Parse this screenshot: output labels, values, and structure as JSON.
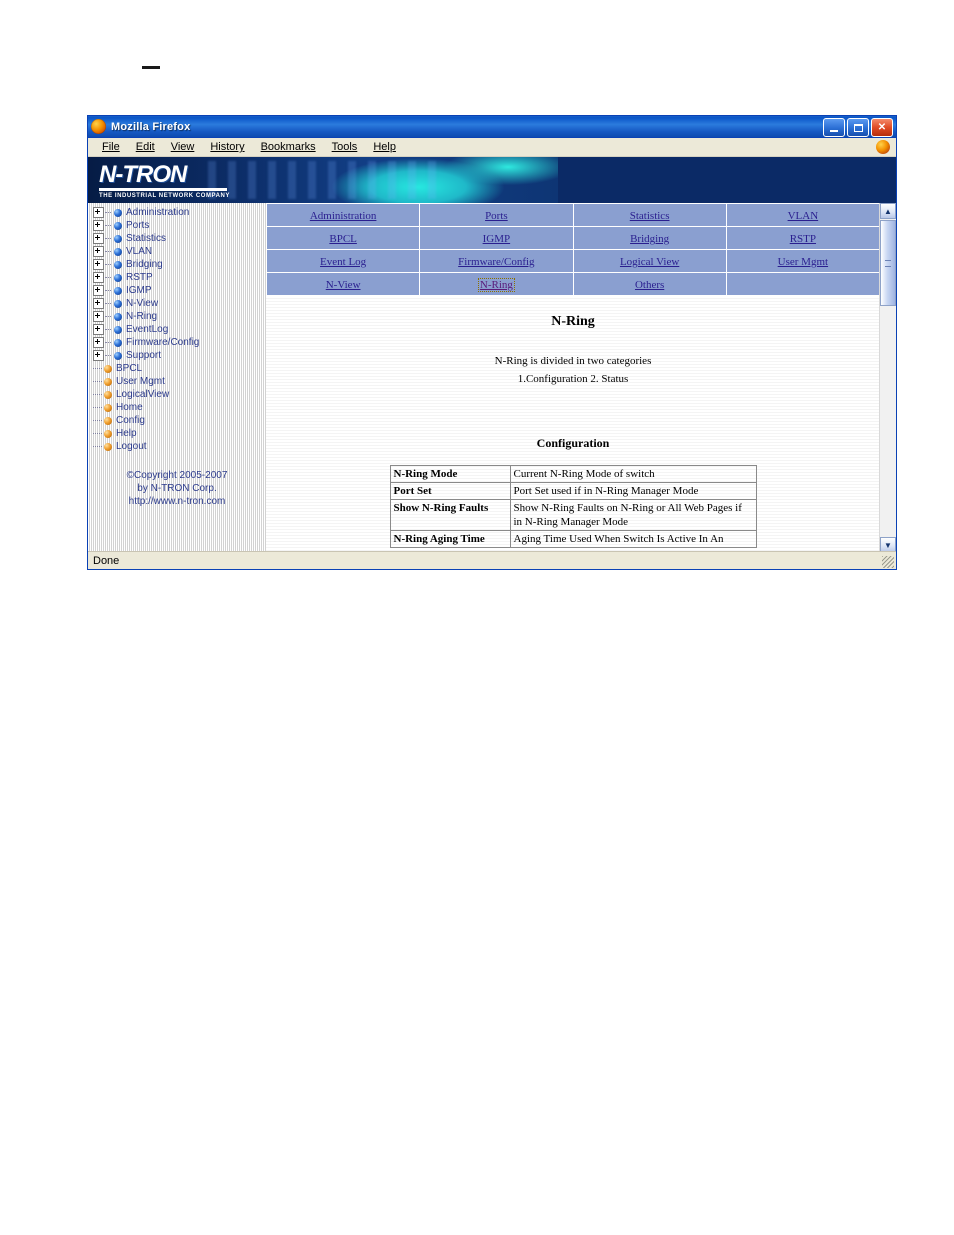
{
  "page": {
    "top_mark": "—"
  },
  "browser": {
    "title": "Mozilla Firefox",
    "window_buttons": [
      {
        "name": "minimize",
        "glyph": "_"
      },
      {
        "name": "maximize",
        "glyph": "□"
      },
      {
        "name": "close",
        "glyph": "✕"
      }
    ],
    "menu": [
      {
        "label": "File",
        "accel": "F"
      },
      {
        "label": "Edit",
        "accel": "E"
      },
      {
        "label": "View",
        "accel": "V"
      },
      {
        "label": "History",
        "accel": "s"
      },
      {
        "label": "Bookmarks",
        "accel": "B"
      },
      {
        "label": "Tools",
        "accel": "T"
      },
      {
        "label": "Help",
        "accel": "H"
      }
    ],
    "status": "Done"
  },
  "banner": {
    "logo_text": "N-TRON",
    "tagline": "THE INDUSTRIAL NETWORK COMPANY"
  },
  "sidebar": {
    "tree": [
      {
        "label": "Administration",
        "type": "branch"
      },
      {
        "label": "Ports",
        "type": "branch"
      },
      {
        "label": "Statistics",
        "type": "branch"
      },
      {
        "label": "VLAN",
        "type": "branch"
      },
      {
        "label": "Bridging",
        "type": "branch"
      },
      {
        "label": "RSTP",
        "type": "branch"
      },
      {
        "label": "IGMP",
        "type": "branch"
      },
      {
        "label": "N-View",
        "type": "branch"
      },
      {
        "label": "N-Ring",
        "type": "branch"
      },
      {
        "label": "EventLog",
        "type": "branch"
      },
      {
        "label": "Firmware/Config",
        "type": "branch"
      },
      {
        "label": "Support",
        "type": "branch"
      },
      {
        "label": "BPCL",
        "type": "leaf"
      },
      {
        "label": "User Mgmt",
        "type": "leaf"
      },
      {
        "label": "LogicalView",
        "type": "leaf"
      },
      {
        "label": "Home",
        "type": "leaf"
      },
      {
        "label": "Config",
        "type": "leaf"
      },
      {
        "label": "Help",
        "type": "leaf"
      },
      {
        "label": "Logout",
        "type": "leaf"
      }
    ],
    "copyright": {
      "line1": "©Copyright 2005-2007",
      "line2": "by N-TRON Corp.",
      "line3": "http://www.n-tron.com"
    }
  },
  "nav": {
    "rows": [
      [
        {
          "label": "Administration",
          "state": "link"
        },
        {
          "label": "Ports",
          "state": "link"
        },
        {
          "label": "Statistics",
          "state": "link"
        },
        {
          "label": "VLAN",
          "state": "link"
        }
      ],
      [
        {
          "label": "BPCL",
          "state": "link"
        },
        {
          "label": "IGMP",
          "state": "link"
        },
        {
          "label": "Bridging",
          "state": "link"
        },
        {
          "label": "RSTP",
          "state": "link"
        }
      ],
      [
        {
          "label": "Event Log",
          "state": "link"
        },
        {
          "label": "Firmware/Config",
          "state": "link"
        },
        {
          "label": "Logical View",
          "state": "link"
        },
        {
          "label": "User Mgmt",
          "state": "link"
        }
      ],
      [
        {
          "label": "N-View",
          "state": "link"
        },
        {
          "label": "N-Ring",
          "state": "focused"
        },
        {
          "label": "Others",
          "state": "link"
        },
        {
          "label": "",
          "state": "empty"
        }
      ]
    ]
  },
  "main": {
    "heading": "N-Ring",
    "intro_line1": "N-Ring is divided in two categories",
    "intro_line2": "1.Configuration   2.  Status",
    "section_title": "Configuration",
    "table": {
      "rows": [
        {
          "key": "N-Ring Mode",
          "value": "Current N-Ring Mode of switch"
        },
        {
          "key": "Port Set",
          "value": "Port Set used if in N-Ring Manager Mode"
        },
        {
          "key": "Show N-Ring Faults",
          "value": "Show N-Ring Faults on N-Ring or All Web Pages if in N-Ring Manager Mode"
        },
        {
          "key": "N-Ring Aging Time",
          "value": "Aging Time Used When Switch Is Active In An"
        }
      ]
    }
  },
  "scrollbar": {
    "up_glyph": "▲",
    "down_glyph": "▼"
  },
  "colors": {
    "titlebar_blue": "#0a55c8",
    "banner_navy": "#0b2a66",
    "nav_cell": "#8a9fd0",
    "link": "#2a1f8f",
    "sidebar_text": "#2b3a8c"
  }
}
